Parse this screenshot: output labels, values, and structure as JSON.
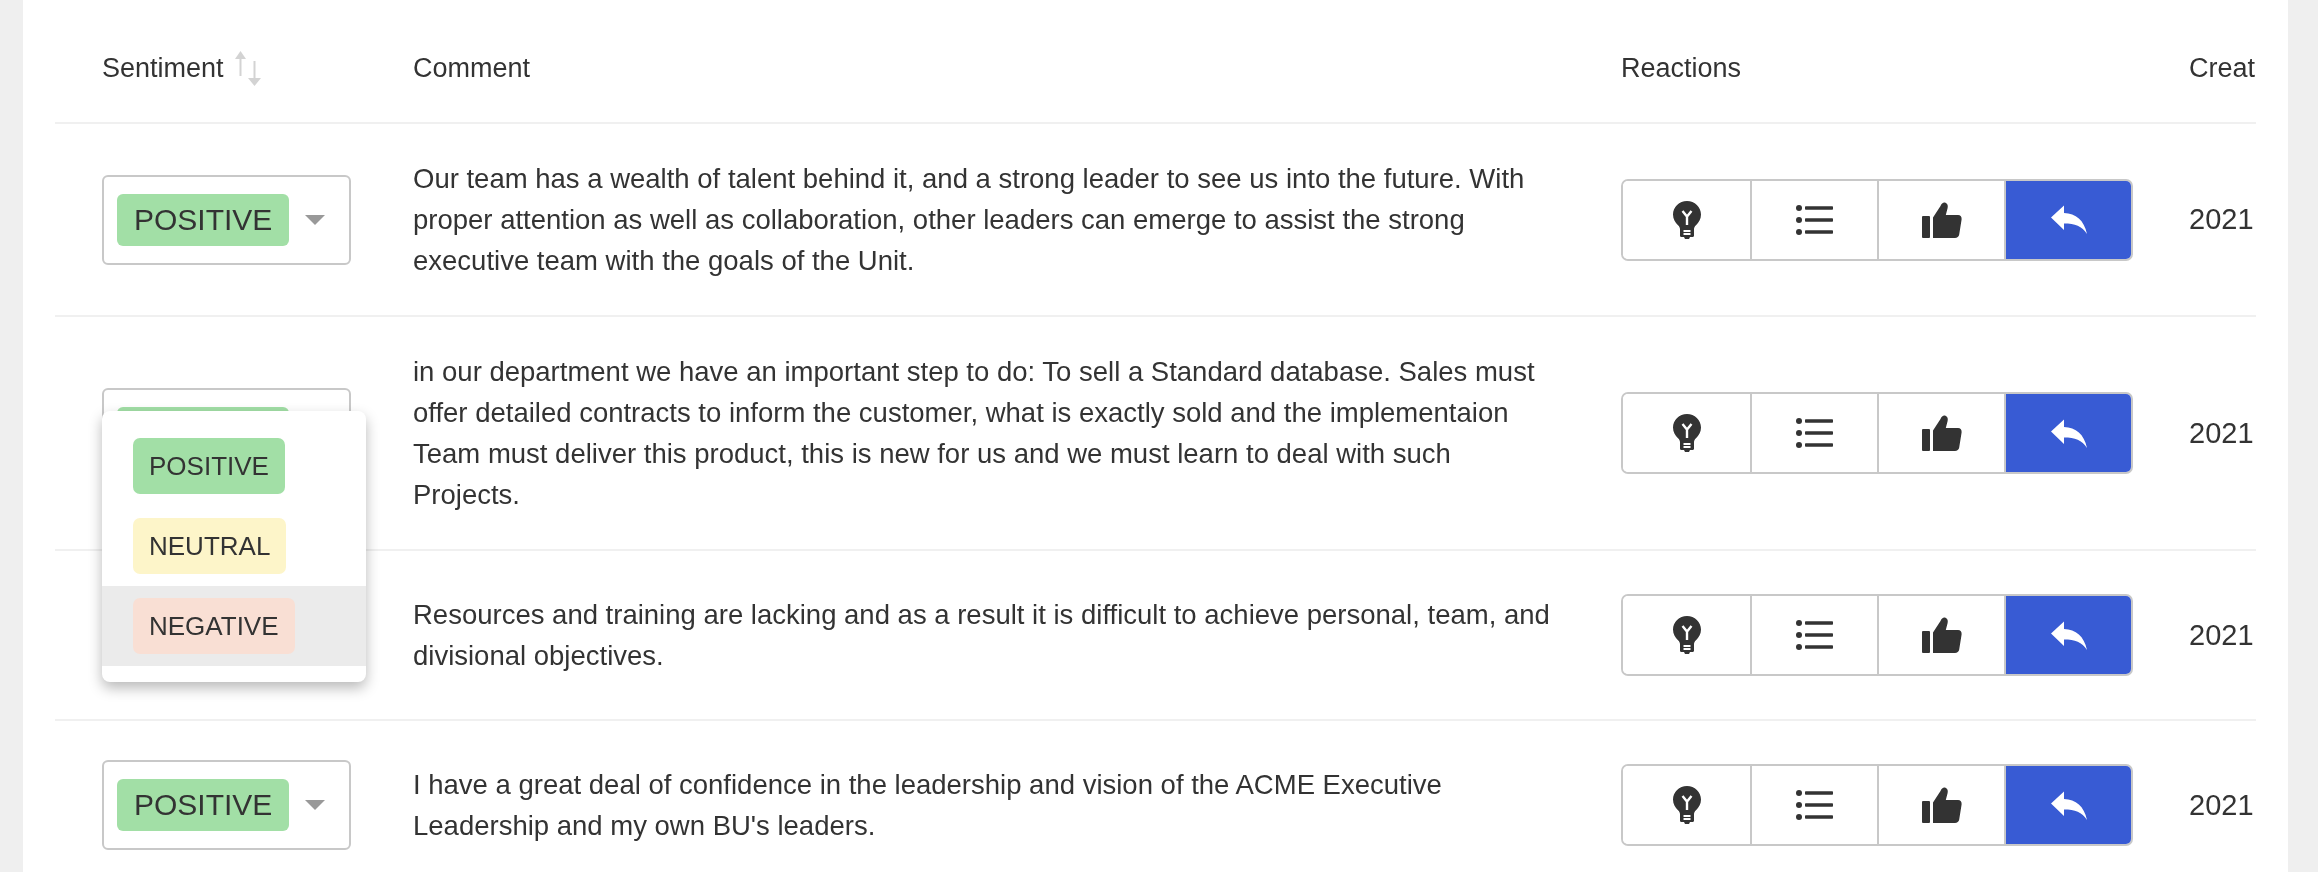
{
  "table": {
    "columns": [
      {
        "label": "Sentiment",
        "sortable": true
      },
      {
        "label": "Comment",
        "sortable": false
      },
      {
        "label": "Reactions",
        "sortable": false
      },
      {
        "label": "Creat",
        "sortable": false
      }
    ],
    "rows": [
      {
        "sentiment": {
          "label": "POSITIVE",
          "color": "#a2dfa6",
          "open": false
        },
        "comment": "Our team has a wealth of talent behind it, and a strong leader to see us into the future. With proper attention as well as collaboration, other leaders can emerge to assist the strong executive team with the goals of the Unit.",
        "reactions": [
          {
            "kind": "idea",
            "selected": false
          },
          {
            "kind": "list",
            "selected": false
          },
          {
            "kind": "like",
            "selected": false
          },
          {
            "kind": "reply",
            "selected": true
          }
        ],
        "created": "2021"
      },
      {
        "sentiment": {
          "color": "#a2dfa6",
          "open": true,
          "options": [
            {
              "label": "POSITIVE",
              "color": "#a2dfa6",
              "highlighted": false
            },
            {
              "label": "NEUTRAL",
              "color": "#fdf5c9",
              "highlighted": false
            },
            {
              "label": "NEGATIVE",
              "color": "#f9dfd4",
              "highlighted": true
            }
          ]
        },
        "comment": "in our department we have an important step to do: To sell a Standard database. Sales must offer detailed contracts to inform the customer, what is exactly sold and the implementaion Team must deliver this product, this is new for us and we must learn to deal with such Projects.",
        "reactions": [
          {
            "kind": "idea",
            "selected": false
          },
          {
            "kind": "list",
            "selected": false
          },
          {
            "kind": "like",
            "selected": false
          },
          {
            "kind": "reply",
            "selected": true
          }
        ],
        "created": "2021"
      },
      {
        "comment": "Resources and training are lacking and as a result it is difficult to achieve personal, team, and divisional objectives.",
        "reactions": [
          {
            "kind": "idea",
            "selected": false
          },
          {
            "kind": "list",
            "selected": false
          },
          {
            "kind": "like",
            "selected": false
          },
          {
            "kind": "reply",
            "selected": true
          }
        ],
        "created": "2021"
      },
      {
        "sentiment": {
          "label": "POSITIVE",
          "color": "#a2dfa6",
          "open": false
        },
        "comment": "I have a great deal of confidence in the leadership and vision of the ACME Executive Leadership and my own BU's leaders.",
        "reactions": [
          {
            "kind": "idea",
            "selected": false
          },
          {
            "kind": "list",
            "selected": false
          },
          {
            "kind": "like",
            "selected": false
          },
          {
            "kind": "reply",
            "selected": true
          }
        ],
        "created": "2021"
      }
    ]
  }
}
